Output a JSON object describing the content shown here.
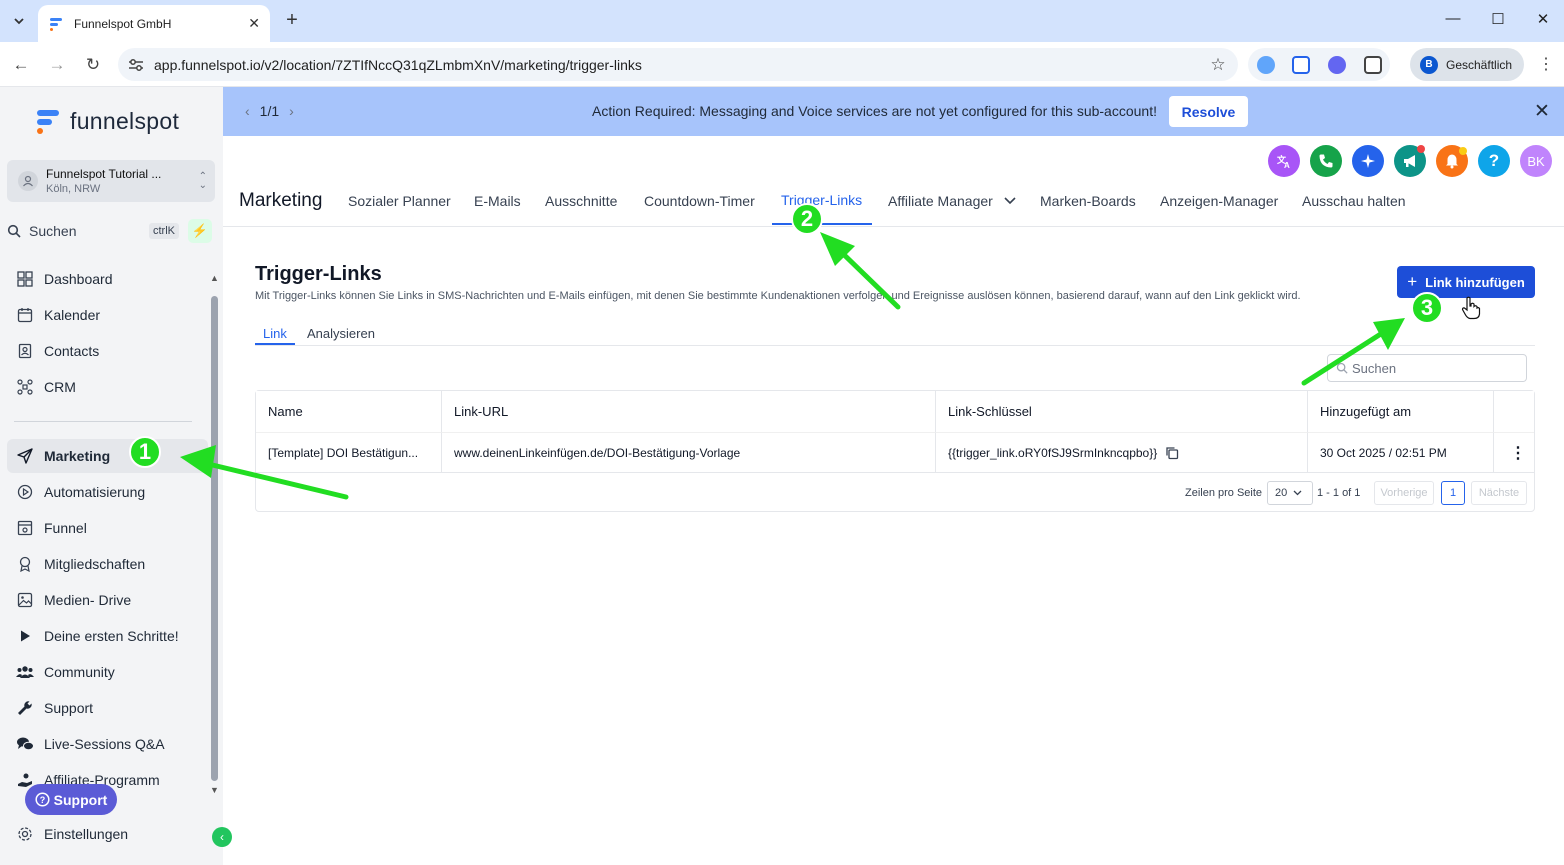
{
  "browser": {
    "tab_title": "Funnelspot GmbH",
    "url": "app.funnelspot.io/v2/location/7ZTIfNccQ31qZLmbmXnV/marketing/trigger-links",
    "profile_initial": "B",
    "profile_label": "Geschäftlich"
  },
  "sidebar": {
    "logo_text": "funnelspot",
    "account_name": "Funnelspot Tutorial ...",
    "account_location": "Köln, NRW",
    "search_label": "Suchen",
    "search_shortcut": "ctrlK",
    "items": [
      {
        "label": "Dashboard",
        "icon": "dashboard-icon"
      },
      {
        "label": "Kalender",
        "icon": "calendar-icon"
      },
      {
        "label": "Contacts",
        "icon": "contacts-icon"
      },
      {
        "label": "CRM",
        "icon": "crm-icon"
      },
      {
        "label": "Marketing",
        "icon": "send-icon"
      },
      {
        "label": "Automatisierung",
        "icon": "automation-icon"
      },
      {
        "label": "Funnel",
        "icon": "funnel-icon"
      },
      {
        "label": "Mitgliedschaften",
        "icon": "membership-icon"
      },
      {
        "label": "Medien- Drive",
        "icon": "media-icon"
      },
      {
        "label": "Deine ersten Schritte!",
        "icon": "play-icon"
      },
      {
        "label": "Community",
        "icon": "community-icon"
      },
      {
        "label": "Support",
        "icon": "wrench-icon"
      },
      {
        "label": "Live-Sessions Q&A",
        "icon": "chat-icon"
      },
      {
        "label": "Affiliate-Programm",
        "icon": "affiliate-icon"
      },
      {
        "label": "Einstellungen",
        "icon": "gear-icon"
      }
    ],
    "support_button": "Support"
  },
  "banner": {
    "pager": "1/1",
    "message": "Action Required: Messaging and Voice services are not yet configured for this sub-account!",
    "resolve": "Resolve"
  },
  "header": {
    "avatar_initials": "BK",
    "help": "?"
  },
  "topnav": {
    "title": "Marketing",
    "tabs": [
      {
        "label": "Sozialer Planner"
      },
      {
        "label": "E-Mails"
      },
      {
        "label": "Ausschnitte"
      },
      {
        "label": "Countdown-Timer"
      },
      {
        "label": "Trigger-Links"
      },
      {
        "label": "Affiliate Manager"
      },
      {
        "label": "Marken-Boards"
      },
      {
        "label": "Anzeigen-Manager"
      },
      {
        "label": "Ausschau halten"
      }
    ]
  },
  "page": {
    "title": "Trigger-Links",
    "description": "Mit Trigger-Links können Sie Links in SMS-Nachrichten und E-Mails einfügen, mit denen Sie bestimmte Kundenaktionen verfolgen und Ereignisse auslösen können, basierend darauf, wann auf den Link geklickt wird.",
    "add_button": "Link hinzufügen",
    "subtabs": [
      "Link",
      "Analysieren"
    ],
    "search_placeholder": "Suchen"
  },
  "table": {
    "columns": [
      "Name",
      "Link-URL",
      "Link-Schlüssel",
      "Hinzugefügt am"
    ],
    "rows": [
      {
        "name": "[Template] DOI Bestätigun...",
        "url": "www.deinenLinkeinfügen.de/DOI-Bestätigung-Vorlage",
        "key": "{{trigger_link.oRY0fSJ9SrmInkncqpbo}}",
        "added": "30 Oct 2025 / 02:51 PM"
      }
    ],
    "footer": {
      "rows_per_page_label": "Zeilen pro Seite",
      "rows_per_page": "20",
      "range": "1 - 1 of 1",
      "prev": "Vorherige",
      "page": "1",
      "next": "Nächste"
    }
  },
  "annotations": {
    "badges": [
      "1",
      "2",
      "3"
    ],
    "color": "#22dd22"
  }
}
